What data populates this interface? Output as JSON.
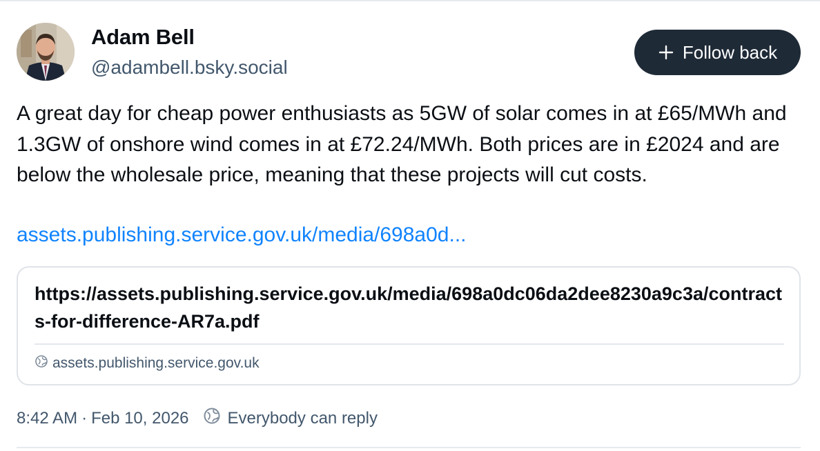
{
  "post": {
    "author": {
      "name": "Adam Bell",
      "handle": "@adambell.bsky.social",
      "avatar_icon": "avatar-photo"
    },
    "follow_button": {
      "label": "Follow back",
      "icon": "plus-icon",
      "background": "#1f2a37"
    },
    "text": "A great day for cheap power enthusiasts as 5GW of solar comes in at £65/MWh and 1.3GW of onshore wind comes in at £72.24/MWh. Both prices are in £2024 and are below the wholesale price, meaning that these projects will cut costs.",
    "link_text": "assets.publishing.service.gov.uk/media/698a0d...",
    "link_color": "#1083fe",
    "link_card": {
      "title": "https://assets.publishing.service.gov.uk/media/698a0dc06da2dee8230a9c3a/contracts-for-difference-AR7a.pdf",
      "domain": "assets.publishing.service.gov.uk",
      "domain_icon": "globe-icon"
    },
    "meta": {
      "time": "8:42 AM",
      "separator": "·",
      "date": "Feb 10, 2026",
      "reply_setting": "Everybody can reply",
      "reply_icon": "globe-icon"
    }
  }
}
